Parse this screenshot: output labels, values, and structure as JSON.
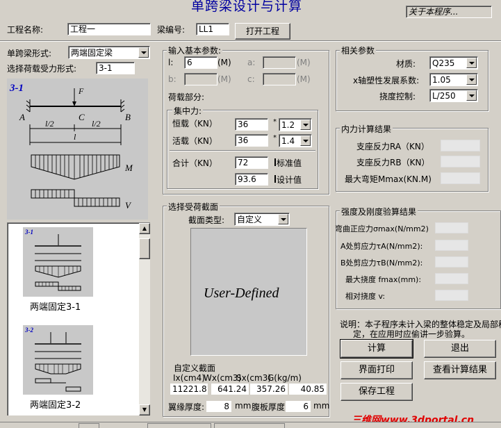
{
  "window": {
    "title": "单跨梁设计与计算",
    "about_label": "关于本程序..."
  },
  "header": {
    "project_label": "工程名称:",
    "project_value": "工程一",
    "beam_no_label": "梁编号:",
    "beam_no_value": "LL1",
    "open_button": "打开工程"
  },
  "left": {
    "beam_form_label": "单跨梁形式:",
    "beam_form_value": "两端固定梁",
    "load_form_label": "选择荷载受力形式:",
    "load_form_value": "3-1",
    "diagram": {
      "id": "3-1",
      "F": "F",
      "A": "A",
      "B": "B",
      "C": "C",
      "l2a": "l/2",
      "l2b": "l/2",
      "l": "l",
      "M": "M",
      "V": "V"
    },
    "list": [
      {
        "id": "3-1",
        "caption": "两端固定3-1"
      },
      {
        "id": "3-2",
        "caption": "两端固定3-2"
      }
    ]
  },
  "basic": {
    "title": "输入基本参数:",
    "l_label": "l:",
    "l_value": "6",
    "l_unit": "(M)",
    "a_label": "a:",
    "a_value": "",
    "a_unit": "(M)",
    "b_label": "b:",
    "b_value": "",
    "b_unit": "(M)",
    "c_label": "c:",
    "c_value": "",
    "c_unit": "(M)",
    "load_part": "荷载部分:",
    "conc_title": "集中力:",
    "dead_label": "恒载（KN）",
    "dead_value": "36",
    "dead_factor": "1.2",
    "live_label": "活载（KN）",
    "live_value": "36",
    "live_factor": "1.4",
    "times": "*",
    "total_label": "合计（KN）",
    "total_std": "72",
    "std_label": "标准值",
    "total_design": "93.6",
    "design_label": "设计值"
  },
  "section": {
    "title": "选择受荷截面",
    "type_label": "截面类型:",
    "type_value": "自定义",
    "preview_text": "User-Defined",
    "custom_title": "自定义截面",
    "headers": [
      "Ix(cm4)",
      "Wx(cm3)",
      "Sx(cm3)",
      "G(kg/m)"
    ],
    "values": [
      "11221.81",
      "641.24",
      "357.26",
      "40.85"
    ],
    "flange_label": "翼缘厚度:",
    "flange_value": "8",
    "flange_unit": "mm",
    "web_label": "腹板厚度:",
    "web_value": "6",
    "web_unit": "mm"
  },
  "params": {
    "title": "相关参数",
    "material_label": "材质:",
    "material_value": "Q235",
    "gamma_label": "x轴塑性发展系数:",
    "gamma_value": "1.05",
    "defl_label": "挠度控制:",
    "defl_value": "L/250"
  },
  "internal": {
    "title": "内力计算结果",
    "ra_label": "支座反力RA（KN）",
    "rb_label": "支座反力RB（KN）",
    "mmax_label": "最大弯矩Mmax(KN.M)"
  },
  "check": {
    "title": "强度及刚度验算结果",
    "sigma_label": "弯曲正应力σmax(N/mm2)",
    "taua_label": "A处剪应力τA(N/mm2):",
    "taub_label": "B处剪应力τB(N/mm2):",
    "fmax_label": "最大挠度  fmax(mm):",
    "v_label": "相对挠度        v:"
  },
  "note": {
    "line1": "说明：本子程序未计入梁的整体稳定及局部稳",
    "line2": "定，在应用时应偷讲一步验算。"
  },
  "buttons": {
    "calc": "计算",
    "exit": "退出",
    "print": "界面打印",
    "view": "查看计算结果",
    "save": "保存工程"
  },
  "watermark": "三维网www.3dportal.cn"
}
